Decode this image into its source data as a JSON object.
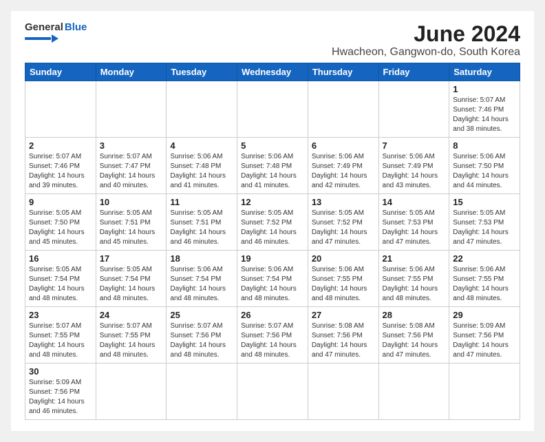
{
  "logo": {
    "general": "General",
    "blue": "Blue"
  },
  "title": "June 2024",
  "subtitle": "Hwacheon, Gangwon-do, South Korea",
  "days_of_week": [
    "Sunday",
    "Monday",
    "Tuesday",
    "Wednesday",
    "Thursday",
    "Friday",
    "Saturday"
  ],
  "weeks": [
    [
      {
        "day": "",
        "info": ""
      },
      {
        "day": "",
        "info": ""
      },
      {
        "day": "",
        "info": ""
      },
      {
        "day": "",
        "info": ""
      },
      {
        "day": "",
        "info": ""
      },
      {
        "day": "",
        "info": ""
      },
      {
        "day": "1",
        "info": "Sunrise: 5:07 AM\nSunset: 7:46 PM\nDaylight: 14 hours and 38 minutes."
      }
    ],
    [
      {
        "day": "2",
        "info": "Sunrise: 5:07 AM\nSunset: 7:46 PM\nDaylight: 14 hours and 39 minutes."
      },
      {
        "day": "3",
        "info": "Sunrise: 5:07 AM\nSunset: 7:47 PM\nDaylight: 14 hours and 40 minutes."
      },
      {
        "day": "4",
        "info": "Sunrise: 5:06 AM\nSunset: 7:48 PM\nDaylight: 14 hours and 41 minutes."
      },
      {
        "day": "5",
        "info": "Sunrise: 5:06 AM\nSunset: 7:48 PM\nDaylight: 14 hours and 41 minutes."
      },
      {
        "day": "6",
        "info": "Sunrise: 5:06 AM\nSunset: 7:49 PM\nDaylight: 14 hours and 42 minutes."
      },
      {
        "day": "7",
        "info": "Sunrise: 5:06 AM\nSunset: 7:49 PM\nDaylight: 14 hours and 43 minutes."
      },
      {
        "day": "8",
        "info": "Sunrise: 5:06 AM\nSunset: 7:50 PM\nDaylight: 14 hours and 44 minutes."
      }
    ],
    [
      {
        "day": "9",
        "info": "Sunrise: 5:05 AM\nSunset: 7:50 PM\nDaylight: 14 hours and 45 minutes."
      },
      {
        "day": "10",
        "info": "Sunrise: 5:05 AM\nSunset: 7:51 PM\nDaylight: 14 hours and 45 minutes."
      },
      {
        "day": "11",
        "info": "Sunrise: 5:05 AM\nSunset: 7:51 PM\nDaylight: 14 hours and 46 minutes."
      },
      {
        "day": "12",
        "info": "Sunrise: 5:05 AM\nSunset: 7:52 PM\nDaylight: 14 hours and 46 minutes."
      },
      {
        "day": "13",
        "info": "Sunrise: 5:05 AM\nSunset: 7:52 PM\nDaylight: 14 hours and 47 minutes."
      },
      {
        "day": "14",
        "info": "Sunrise: 5:05 AM\nSunset: 7:53 PM\nDaylight: 14 hours and 47 minutes."
      },
      {
        "day": "15",
        "info": "Sunrise: 5:05 AM\nSunset: 7:53 PM\nDaylight: 14 hours and 47 minutes."
      }
    ],
    [
      {
        "day": "16",
        "info": "Sunrise: 5:05 AM\nSunset: 7:54 PM\nDaylight: 14 hours and 48 minutes."
      },
      {
        "day": "17",
        "info": "Sunrise: 5:05 AM\nSunset: 7:54 PM\nDaylight: 14 hours and 48 minutes."
      },
      {
        "day": "18",
        "info": "Sunrise: 5:06 AM\nSunset: 7:54 PM\nDaylight: 14 hours and 48 minutes."
      },
      {
        "day": "19",
        "info": "Sunrise: 5:06 AM\nSunset: 7:54 PM\nDaylight: 14 hours and 48 minutes."
      },
      {
        "day": "20",
        "info": "Sunrise: 5:06 AM\nSunset: 7:55 PM\nDaylight: 14 hours and 48 minutes."
      },
      {
        "day": "21",
        "info": "Sunrise: 5:06 AM\nSunset: 7:55 PM\nDaylight: 14 hours and 48 minutes."
      },
      {
        "day": "22",
        "info": "Sunrise: 5:06 AM\nSunset: 7:55 PM\nDaylight: 14 hours and 48 minutes."
      }
    ],
    [
      {
        "day": "23",
        "info": "Sunrise: 5:07 AM\nSunset: 7:55 PM\nDaylight: 14 hours and 48 minutes."
      },
      {
        "day": "24",
        "info": "Sunrise: 5:07 AM\nSunset: 7:55 PM\nDaylight: 14 hours and 48 minutes."
      },
      {
        "day": "25",
        "info": "Sunrise: 5:07 AM\nSunset: 7:56 PM\nDaylight: 14 hours and 48 minutes."
      },
      {
        "day": "26",
        "info": "Sunrise: 5:07 AM\nSunset: 7:56 PM\nDaylight: 14 hours and 48 minutes."
      },
      {
        "day": "27",
        "info": "Sunrise: 5:08 AM\nSunset: 7:56 PM\nDaylight: 14 hours and 47 minutes."
      },
      {
        "day": "28",
        "info": "Sunrise: 5:08 AM\nSunset: 7:56 PM\nDaylight: 14 hours and 47 minutes."
      },
      {
        "day": "29",
        "info": "Sunrise: 5:09 AM\nSunset: 7:56 PM\nDaylight: 14 hours and 47 minutes."
      }
    ],
    [
      {
        "day": "30",
        "info": "Sunrise: 5:09 AM\nSunset: 7:56 PM\nDaylight: 14 hours and 46 minutes."
      },
      {
        "day": "",
        "info": ""
      },
      {
        "day": "",
        "info": ""
      },
      {
        "day": "",
        "info": ""
      },
      {
        "day": "",
        "info": ""
      },
      {
        "day": "",
        "info": ""
      },
      {
        "day": "",
        "info": ""
      }
    ]
  ],
  "colors": {
    "header_bg": "#1565c0",
    "logo_blue": "#1565c0"
  }
}
